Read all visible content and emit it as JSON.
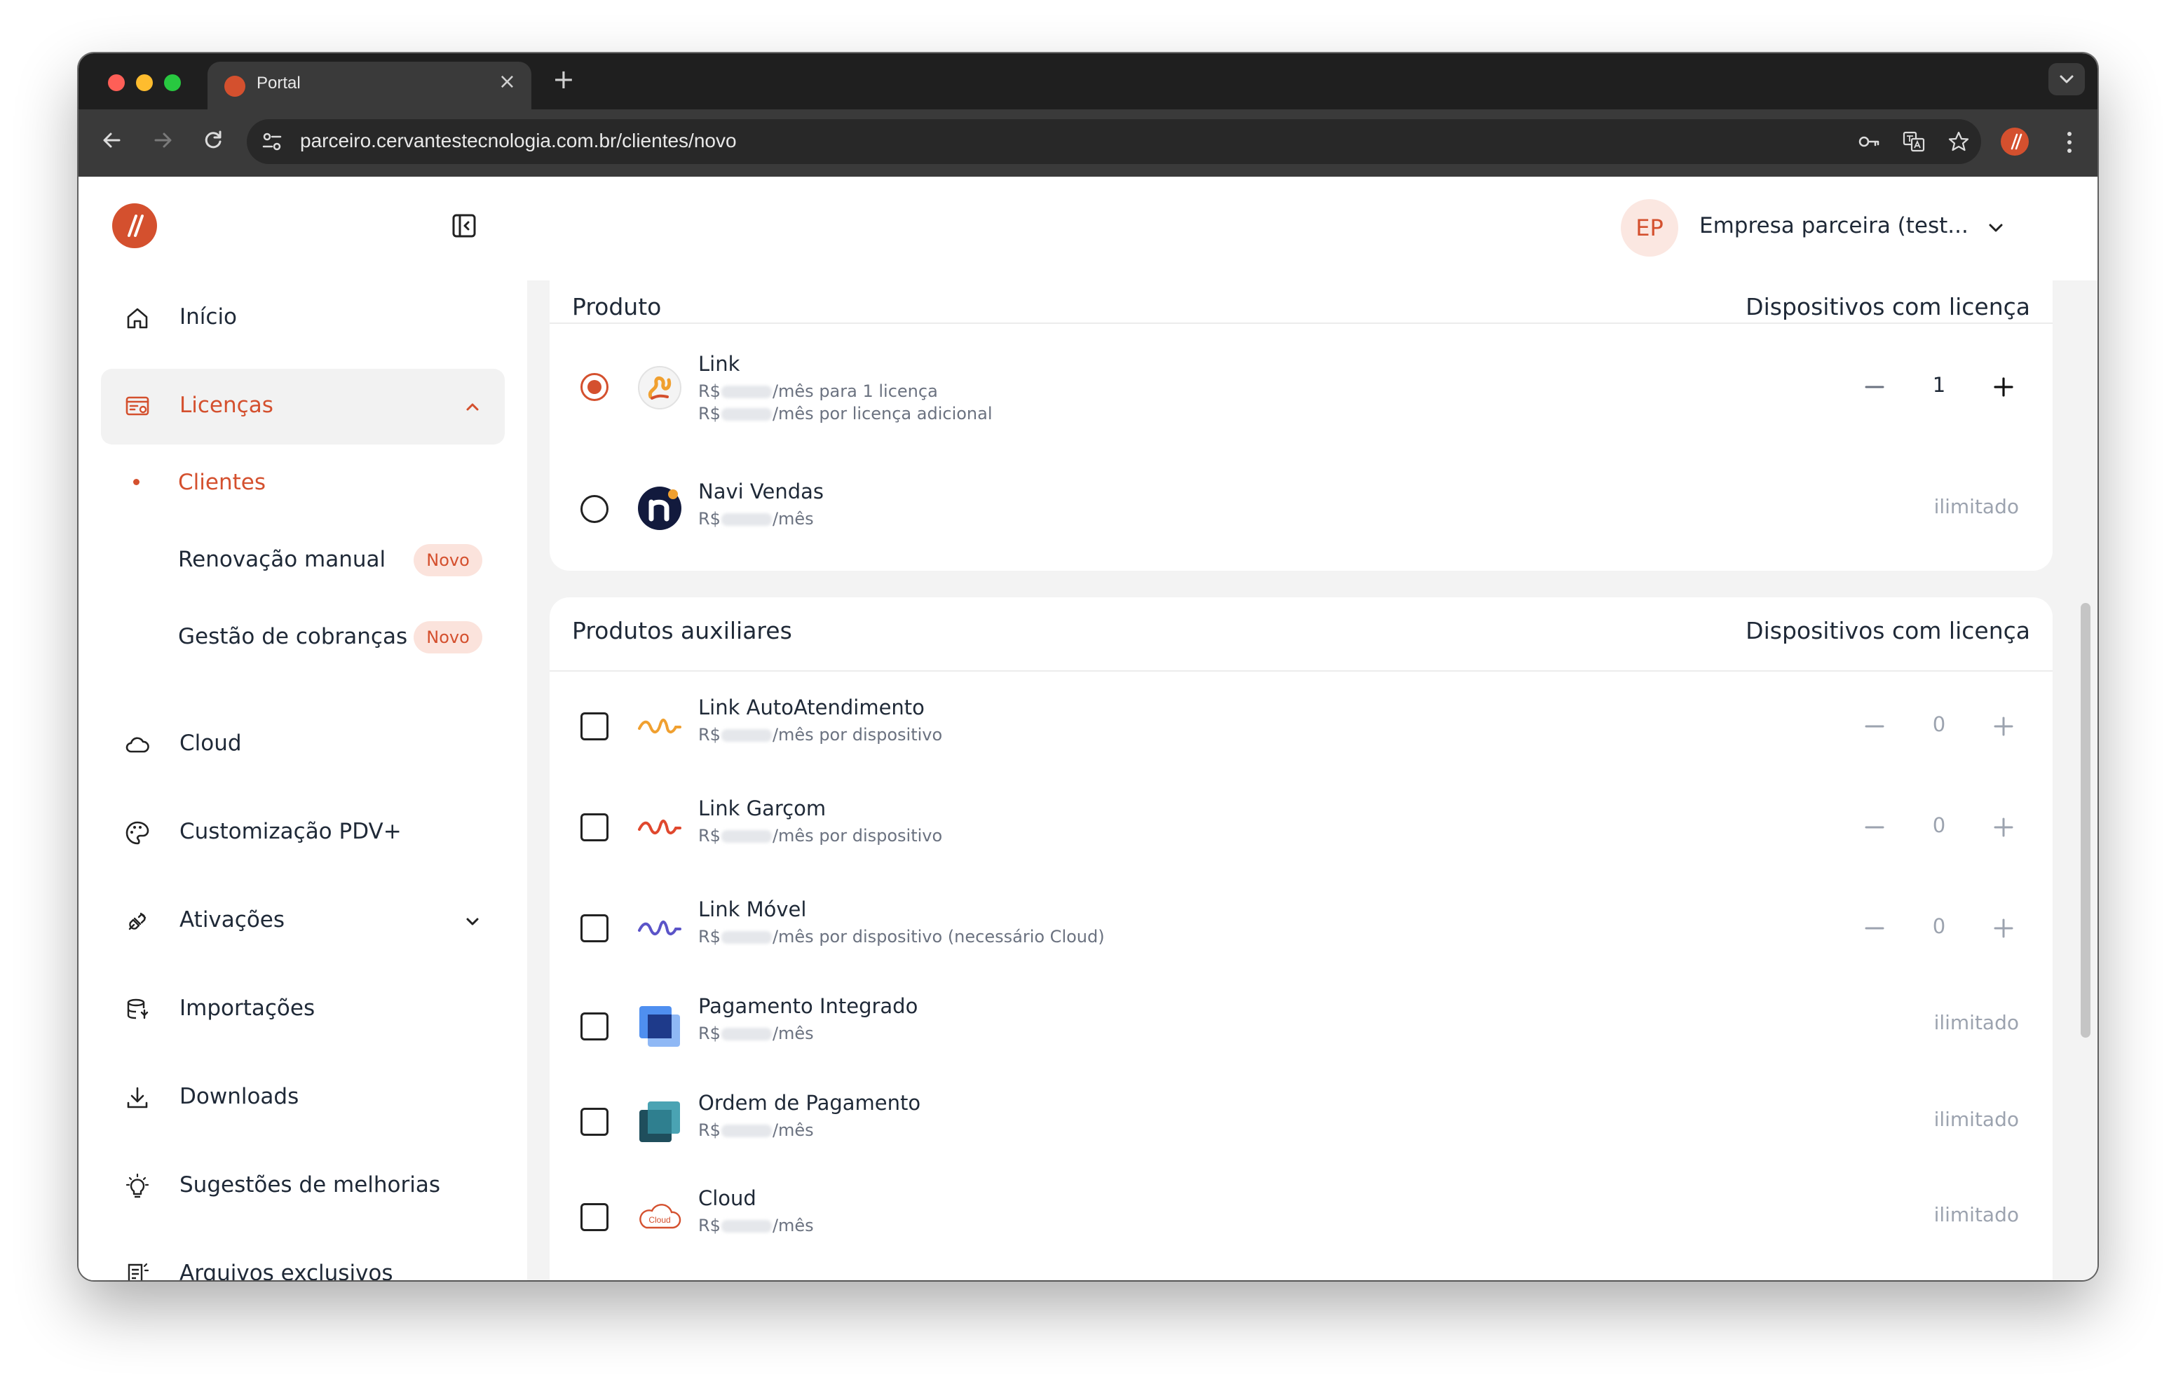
{
  "browser": {
    "tab_title": "Portal",
    "tab_close": "×",
    "new_tab": "+",
    "url": "parceiro.cervantestecnologia.com.br/clientes/novo"
  },
  "sidebar": {
    "logo_text": "//",
    "items": [
      {
        "label": "Início",
        "icon": "home-icon"
      },
      {
        "label": "Licenças",
        "icon": "license-icon",
        "expanded": true
      },
      {
        "label": "Cloud",
        "icon": "cloud-icon"
      },
      {
        "label": "Customização PDV+",
        "icon": "palette-icon"
      },
      {
        "label": "Ativações",
        "icon": "plug-icon"
      },
      {
        "label": "Importações",
        "icon": "database-import-icon"
      },
      {
        "label": "Downloads",
        "icon": "download-icon"
      },
      {
        "label": "Sugestões de melhorias",
        "icon": "lightbulb-icon"
      },
      {
        "label": "Arquivos exclusivos",
        "icon": "document-icon"
      }
    ],
    "subitems": [
      {
        "label": "Clientes",
        "active": true
      },
      {
        "label": "Renovação manual",
        "badge": "Novo"
      },
      {
        "label": "Gestão de cobranças",
        "badge": "Novo"
      }
    ]
  },
  "header": {
    "avatar_initials": "EP",
    "company_name": "Empresa parceira (test..."
  },
  "colors": {
    "accent": "#d4502e",
    "badge_bg": "#fbe3dc",
    "muted_text": "#9ca3af"
  },
  "produto": {
    "title": "Produto",
    "column": "Dispositivos com licença",
    "items": [
      {
        "name": "Link",
        "currency": "R$",
        "price_suffix": "/mês para 1 licença",
        "currency2": "R$",
        "price2_suffix": "/mês por licença adicional",
        "selected": true,
        "quantity": "1"
      },
      {
        "name": "Navi Vendas",
        "currency": "R$",
        "price_suffix": "/mês",
        "selected": false,
        "quantity": "ilimitado"
      }
    ]
  },
  "auxiliares": {
    "title": "Produtos auxiliares",
    "column": "Dispositivos com licença",
    "items": [
      {
        "name": "Link AutoAtendimento",
        "currency": "R$",
        "price_suffix": "/mês por dispositivo",
        "quantity": "0"
      },
      {
        "name": "Link Garçom",
        "currency": "R$",
        "price_suffix": "/mês por dispositivo",
        "quantity": "0"
      },
      {
        "name": "Link Móvel",
        "currency": "R$",
        "price_suffix": "/mês por dispositivo (necessário Cloud)",
        "quantity": "0"
      },
      {
        "name": "Pagamento Integrado",
        "currency": "R$",
        "price_suffix": "/mês",
        "quantity": "ilimitado"
      },
      {
        "name": "Ordem de Pagamento",
        "currency": "R$",
        "price_suffix": "/mês",
        "quantity": "ilimitado"
      },
      {
        "name": "Cloud",
        "currency": "R$",
        "price_suffix": "/mês",
        "quantity": "ilimitado",
        "logo_text": "Cloud"
      }
    ]
  }
}
